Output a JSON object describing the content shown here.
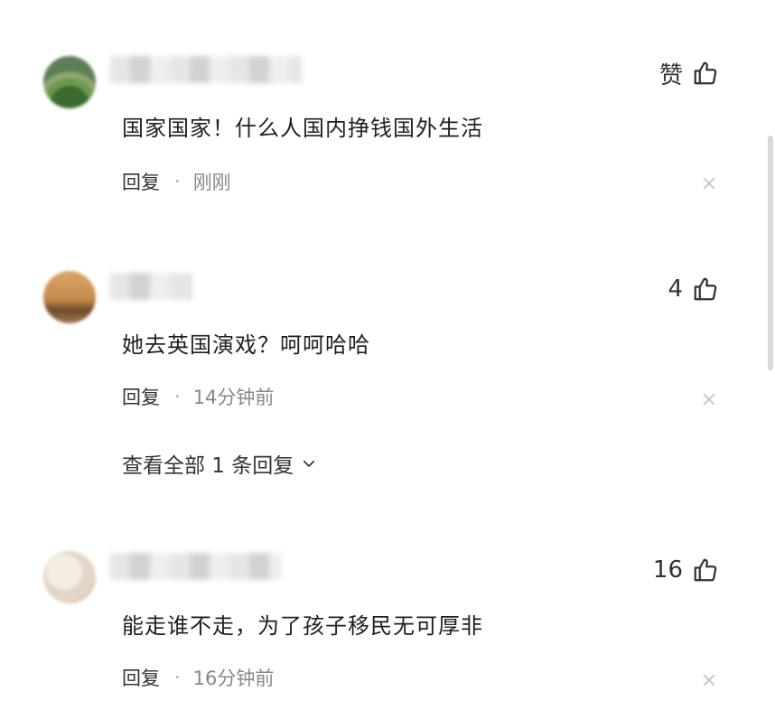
{
  "comments": [
    {
      "text": "国家国家！什么人国内挣钱国外生活",
      "like_label": "赞",
      "reply_label": "回复",
      "dot": "·",
      "time": "刚刚"
    },
    {
      "text": "她去英国演戏？呵呵哈哈",
      "like_label": "4",
      "reply_label": "回复",
      "dot": "·",
      "time": "14分钟前",
      "view_replies": "查看全部 1 条回复"
    },
    {
      "text": "能走谁不走，为了孩子移民无可厚非",
      "like_label": "16",
      "reply_label": "回复",
      "dot": "·",
      "time": "16分钟前"
    }
  ],
  "icons": {
    "like": "thumbs-up-icon",
    "close": "close-icon",
    "expand": "chevron-down-icon"
  },
  "colors": {
    "text": "#1f1f1f",
    "meta": "#888888",
    "close": "#c8c8c8"
  }
}
